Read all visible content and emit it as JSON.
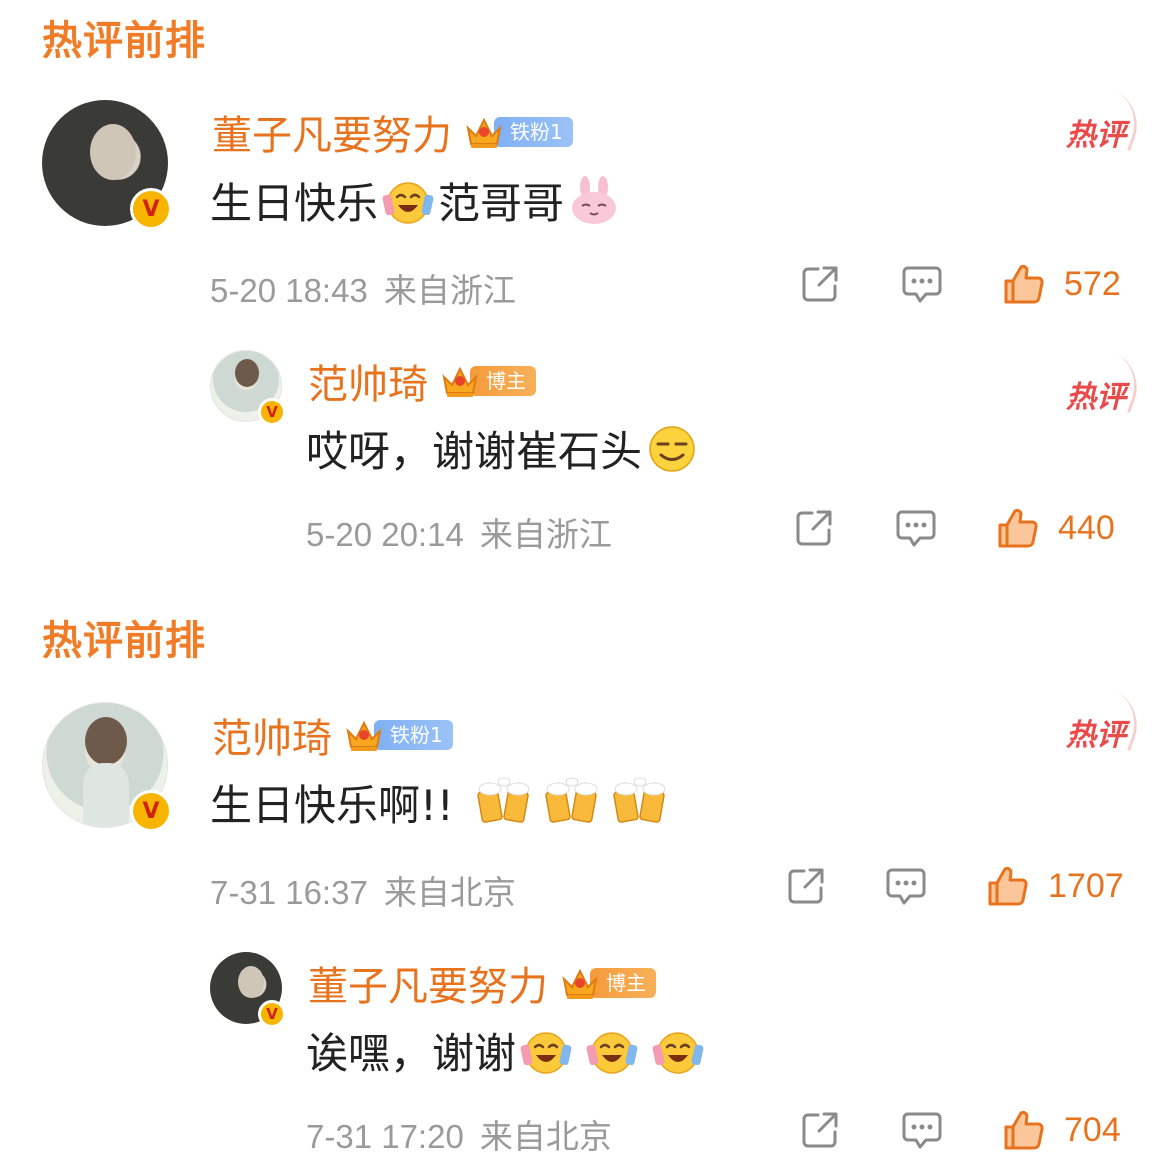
{
  "sections": [
    {
      "title": "热评前排",
      "comment": {
        "author": "董子凡要努力",
        "badge_text": "铁粉1",
        "badge_type": "fan",
        "hot_label": "热评",
        "text_parts": [
          "生日快乐",
          "范哥哥"
        ],
        "emojis": [
          "laugh-cry-emoji",
          "bunny-emoji"
        ],
        "date": "5-20 18:43",
        "location": "来自浙江",
        "likes": "572",
        "reply": {
          "author": "范帅琦",
          "badge_text": "博主",
          "badge_type": "host",
          "hot_label": "热评",
          "text_parts": [
            "哎呀，谢谢崔石头"
          ],
          "emojis": [
            "smirk-emoji"
          ],
          "date": "5-20 20:14",
          "location": "来自浙江",
          "likes": "440"
        }
      }
    },
    {
      "title": "热评前排",
      "comment": {
        "author": "范帅琦",
        "badge_text": "铁粉1",
        "badge_type": "fan",
        "hot_label": "热评",
        "text_parts": [
          "生日快乐啊!!"
        ],
        "emojis": [
          "beer-cheers-emoji",
          "beer-cheers-emoji",
          "beer-cheers-emoji"
        ],
        "date": "7-31 16:37",
        "location": "来自北京",
        "likes": "1707",
        "reply": {
          "author": "董子凡要努力",
          "badge_text": "博主",
          "badge_type": "host",
          "text_parts": [
            "诶嘿，谢谢"
          ],
          "emojis": [
            "laugh-cry-emoji",
            "laugh-cry-emoji",
            "laugh-cry-emoji"
          ],
          "date": "7-31 17:20",
          "location": "来自北京",
          "likes": "704"
        }
      }
    }
  ],
  "colors": {
    "accent": "#e8731f",
    "hot": "#ea4a4a",
    "meta": "#9a9a9a",
    "fan_badge": "#7fb0f4",
    "host_badge": "#f59a3a"
  },
  "icons": {
    "share": "share-icon",
    "comment": "comment-icon",
    "like": "thumbs-up-icon",
    "verified": "verified-v-badge",
    "crown": "crown-icon"
  }
}
